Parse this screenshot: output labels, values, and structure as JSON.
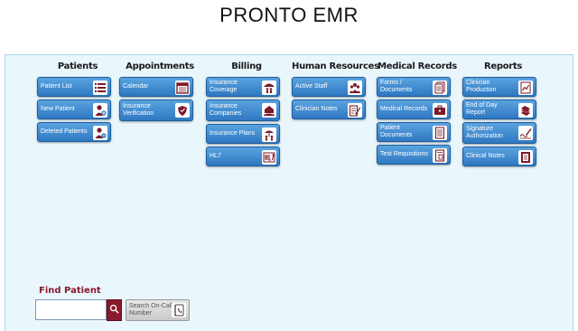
{
  "app": {
    "title": "PRONTO EMR"
  },
  "colors": {
    "button_top": "#5aa3df",
    "button_bottom": "#2f78c2",
    "icon_fg": "#7a1b2a",
    "panel_bg": "#e9f7fd",
    "find_red": "#8b1a2b"
  },
  "columns": [
    {
      "title": "Patients",
      "items": [
        {
          "label": "Patient List",
          "icon": "list-icon"
        },
        {
          "label": "New Patient",
          "icon": "add-person-icon"
        },
        {
          "label": "Deleted Patients",
          "icon": "remove-person-icon"
        }
      ]
    },
    {
      "title": "Appointments",
      "items": [
        {
          "label": "Calendar",
          "icon": "calendar-icon"
        },
        {
          "label": "Insurance Verification",
          "icon": "insurance-hands-icon"
        }
      ]
    },
    {
      "title": "Billing",
      "items": [
        {
          "label": "Insurance Coverage",
          "icon": "umbrella-family-icon"
        },
        {
          "label": "Insurance Companies",
          "icon": "house-hand-icon"
        },
        {
          "label": "Insurance Plans",
          "icon": "umbrella-people-icon"
        },
        {
          "label": "HL7",
          "icon": "hl7-icon"
        }
      ]
    },
    {
      "title": "Human Resources",
      "items": [
        {
          "label": "Active Staff",
          "icon": "staff-group-icon"
        },
        {
          "label": "Clinician Notes",
          "icon": "notepad-pencil-icon"
        }
      ]
    },
    {
      "title": "Medical Records",
      "items": [
        {
          "label": "Forms / Documents",
          "icon": "documents-icon"
        },
        {
          "label": "Medical Records",
          "icon": "briefcase-icon"
        },
        {
          "label": "Patient Documents",
          "icon": "document-lines-icon"
        },
        {
          "label": "Test Requisitions",
          "icon": "test-form-icon"
        }
      ]
    },
    {
      "title": "Reports",
      "items": [
        {
          "label": "Clinician Production",
          "icon": "chart-report-icon"
        },
        {
          "label": "End of Day Report",
          "icon": "stack-papers-icon"
        },
        {
          "label": "Signature Authorization",
          "icon": "signature-pen-icon"
        },
        {
          "label": "Clinical Notes",
          "icon": "notes-book-icon"
        }
      ]
    }
  ],
  "find_patient": {
    "label": "Find Patient",
    "input_value": "",
    "oncall_label": "Search On-Call Number"
  }
}
